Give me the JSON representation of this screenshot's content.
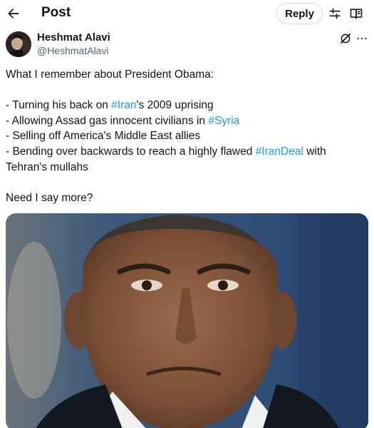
{
  "topbar": {
    "back_icon": "arrow-left-icon",
    "title": "Post",
    "reply_label": "Reply",
    "filter_icon": "sliders-icon",
    "reader_icon": "book-open-icon"
  },
  "author": {
    "name": "Heshmat Alavi",
    "handle": "@HeshmatAlavi",
    "avatar_icon": "profile-photo",
    "grok_icon": "grok-icon",
    "more_icon": "more-horizontal-icon"
  },
  "tweet": {
    "line1": "What I remember about President Obama:",
    "b1_pre": "- Turning his back on ",
    "b1_tag": "#Iran",
    "b1_post": "'s 2009 uprising",
    "b2_pre": "- Allowing Assad gas innocent civilians in ",
    "b2_tag": "#Syria",
    "b3": "- Selling off America's Middle East allies",
    "b4_pre": "- Bending over backwards to reach a highly flawed ",
    "b4_tag": "#IranDeal",
    "b4_post": " with",
    "b4_cont": "Tehran's mullahs",
    "closing": "Need I say more?"
  },
  "colors": {
    "link": "#1d9bf0",
    "text": "#0f1419",
    "secondary": "#536471",
    "border": "#cfd9de"
  }
}
